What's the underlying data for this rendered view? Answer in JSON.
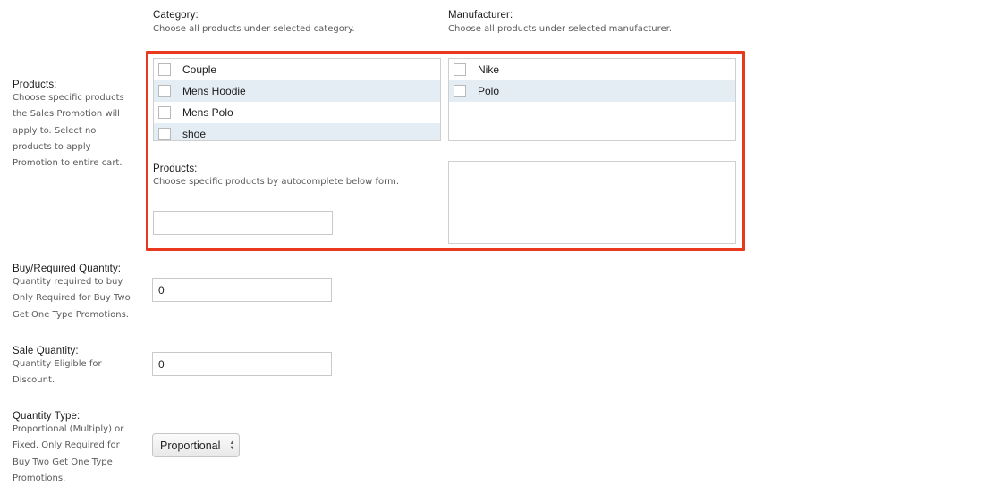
{
  "category": {
    "title": "Category:",
    "description": "Choose all products under selected category.",
    "items": [
      {
        "label": "Couple",
        "checked": false
      },
      {
        "label": "Mens Hoodie",
        "checked": false
      },
      {
        "label": "Mens Polo",
        "checked": false
      },
      {
        "label": "shoe",
        "checked": false
      }
    ]
  },
  "manufacturer": {
    "title": "Manufacturer:",
    "description": "Choose all products under selected manufacturer.",
    "items": [
      {
        "label": "Nike",
        "checked": false
      },
      {
        "label": "Polo",
        "checked": false
      }
    ]
  },
  "products_autocomplete": {
    "title": "Products:",
    "description": "Choose specific products by autocomplete below form.",
    "value": "",
    "placeholder": ""
  },
  "products_side": {
    "title": "Products:",
    "description_lines": [
      "Choose specific products",
      "the Sales Promotion will",
      "apply to. Select no",
      "products to apply",
      "Promotion to entire cart."
    ]
  },
  "buy_quantity": {
    "title": "Buy/Required Quantity:",
    "description_lines": [
      "Quantity required to buy.",
      "Only Required for Buy Two",
      "Get One Type Promotions."
    ],
    "value": "0"
  },
  "sale_quantity": {
    "title": "Sale Quantity:",
    "description_lines": [
      "Quantity Eligible for",
      "Discount."
    ],
    "value": "0"
  },
  "quantity_type": {
    "title": "Quantity Type:",
    "description_lines": [
      "Proportional (Multiply) or",
      "Fixed. Only Required for",
      "Buy Two Get One Type",
      "Promotions."
    ],
    "selected": "Proportional",
    "arrow_up": "▲",
    "arrow_down": "▼"
  },
  "colors": {
    "highlight_border": "#e8391e",
    "row_alt_bg": "#e4ecf4"
  }
}
